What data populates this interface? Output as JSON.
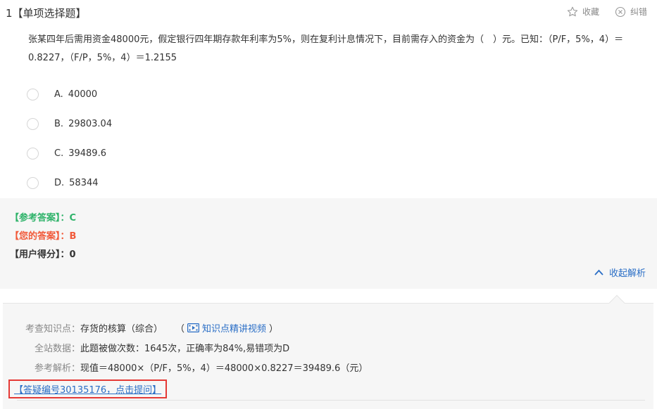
{
  "question": {
    "number": "1",
    "type": "【单项选择题】",
    "stem": "张某四年后需用资金48000元，假定银行四年期存款年利率为5%，则在复利计息情况下，目前需存入的资金为（　）元。已知：（P/F，5%，4）＝0.8227，（F/P，5%，4）＝1.2155"
  },
  "actions": {
    "favorite": "收藏",
    "report": "纠错"
  },
  "options": [
    {
      "letter": "A.",
      "text": "40000"
    },
    {
      "letter": "B.",
      "text": "29803.04"
    },
    {
      "letter": "C.",
      "text": "39489.6"
    },
    {
      "letter": "D.",
      "text": "58344"
    }
  ],
  "answers": {
    "reference_label": "【参考答案】：",
    "reference_value": "C",
    "yours_label": "【您的答案】：",
    "yours_value": "B",
    "score_label": "【用户得分】：",
    "score_value": "0",
    "collapse_label": "收起解析"
  },
  "analysis": {
    "knowledge_label": "考查知识点：",
    "knowledge_value": "存货的核算（综合）",
    "video_open": "（",
    "video_label": "知识点精讲视频",
    "video_close": "）",
    "stats_label": "全站数据：",
    "stats_value": "此题被做次数：1645次，正确率为84%,易错项为D",
    "explain_label": "参考解析：",
    "explain_value": "现值＝48000×（P/F，5%，4）＝48000×0.8227＝39489.6（元）",
    "ask_link": "【答疑编号30135176，点击提问】"
  },
  "colors": {
    "correct": "#2fb36a",
    "wrong": "#f15a3a",
    "link": "#2a6ec6",
    "highlight_border": "#e53935"
  }
}
